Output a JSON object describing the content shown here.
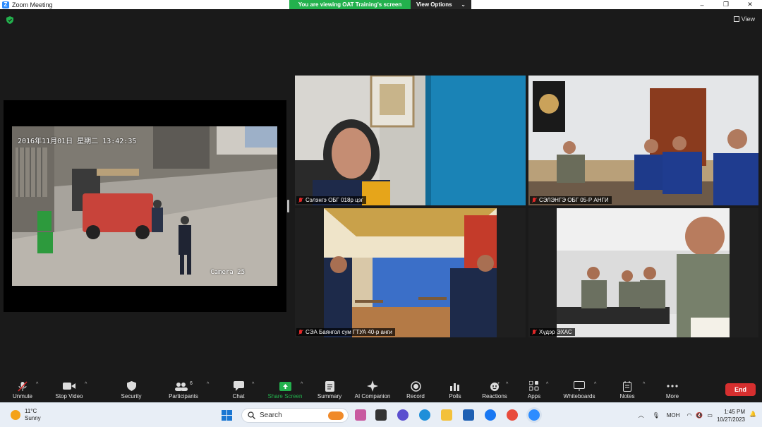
{
  "titlebar": {
    "app_title": "Zoom Meeting",
    "share_banner": "You are viewing OAT Training's screen",
    "view_options": "View Options",
    "view_options_caret": "⌄",
    "minimize": "–",
    "maximize": "❐",
    "close": "✕"
  },
  "meeting": {
    "view_label": "View",
    "shared_screen": {
      "timestamp": "2016年11月01日  星期二  13:42:35",
      "camera": "Camera 25"
    },
    "participants": [
      {
        "name": "Сэлэнгэ ОБГ 018р цэг",
        "muted": true
      },
      {
        "name": "СЭЛЭНГЭ ОБГ 05-Р АНГИ",
        "muted": true
      },
      {
        "name": "СЭА Баянгол сум ГТУА 40-р анги",
        "muted": true
      },
      {
        "name": "Хүдэр ЭХАС",
        "muted": true
      }
    ]
  },
  "toolbar": {
    "unmute": "Unmute",
    "stop_video": "Stop Video",
    "security": "Security",
    "participants": "Participants",
    "participants_count": "6",
    "chat": "Chat",
    "share_screen": "Share Screen",
    "summary": "Summary",
    "ai_companion": "AI Companion",
    "record": "Record",
    "polls": "Polls",
    "reactions": "Reactions",
    "apps": "Apps",
    "whiteboards": "Whiteboards",
    "notes": "Notes",
    "more": "More",
    "end": "End",
    "caret": "^"
  },
  "taskbar": {
    "temperature": "11°C",
    "weather": "Sunny",
    "search": "Search",
    "language": "МОН",
    "time": "1:45 PM",
    "date": "10/27/2023"
  },
  "colors": {
    "banner_green": "#23b14d",
    "share_screen_green": "#23b14d",
    "end_red": "#d62f2f",
    "muted_red": "#e02828"
  }
}
